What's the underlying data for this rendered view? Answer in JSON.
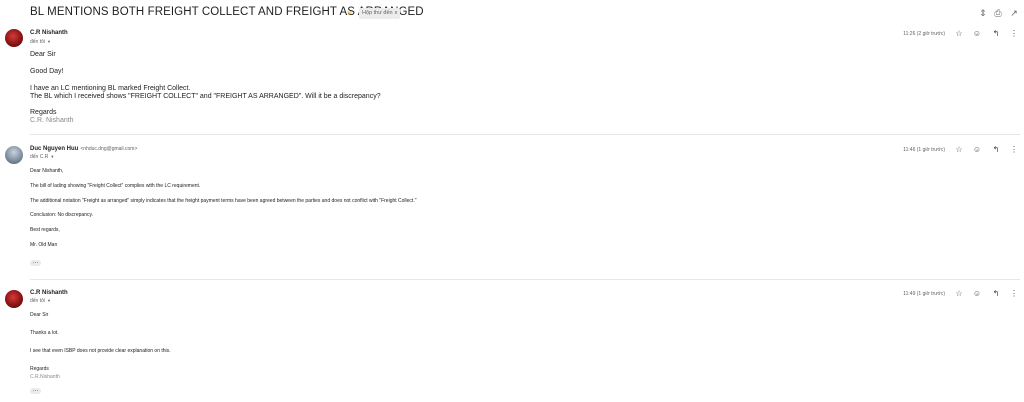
{
  "thread": {
    "subject": "BL MENTIONS BOTH FREIGHT COLLECT AND FREIGHT AS ARRANGED",
    "label": "Hộp thư đến",
    "label_close": "x",
    "label_color": "#f2b400"
  },
  "toolbar": {
    "icons": [
      "collapse-icon",
      "print-icon",
      "open-in-new-window-icon"
    ]
  },
  "messages": [
    {
      "sender": "C.R Nishanth",
      "sender_email": "",
      "to": "đến tôi",
      "time": "11:26 (2 giờ trước)",
      "lines": [
        "Dear Sir",
        "Good Day!",
        "I have an LC mentioning BL marked Freight Collect.",
        "The BL which I received shows \"FREIGHT COLLECT\" and \"FREIGHT AS ARRANGED\". Will it be a discrepancy?",
        "Regards"
      ],
      "signature": "C.R. Nishanth"
    },
    {
      "sender": "Duc Nguyen Huu",
      "sender_email": "<nhduc.dng@gmail.com>",
      "to": "đến C.R",
      "time": "11:46 (1 giờ trước)",
      "lines": [
        "Dear Nishanth,",
        "The bill of lading showing \"Freight Collect\" complies with the LC requirement.",
        "The additional notation \"Freight as arranged\" simply indicates that the freight payment terms have been agreed between the parties and does not conflict with \"Freight Collect.\"",
        "Conclusion: No discrepancy.",
        "Best regards,",
        "Mr. Old Man"
      ]
    },
    {
      "sender": "C.R Nishanth",
      "sender_email": "",
      "to": "đến tôi",
      "time": "11:49 (1 giờ trước)",
      "lines": [
        "Dear Sir",
        "Thanks a lot.",
        "I see that even ISBP does not provide clear explanation on this.",
        "Regards"
      ],
      "signature": "C.R.Nishanth"
    }
  ]
}
